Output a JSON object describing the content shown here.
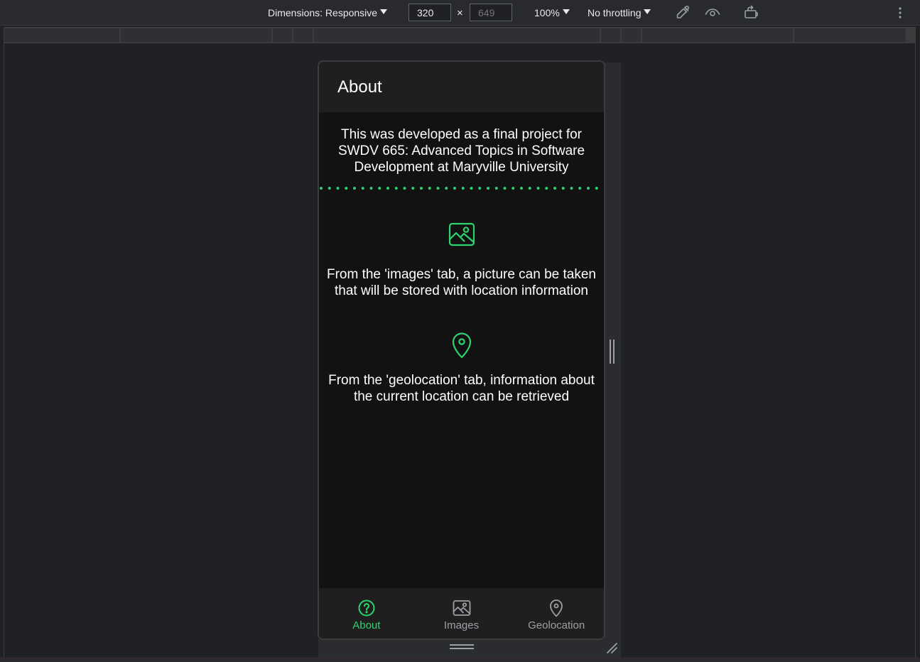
{
  "toolbar": {
    "dimensions_label": "Dimensions: Responsive",
    "width_value": "320",
    "height_placeholder": "649",
    "times": "×",
    "zoom_label": "100%",
    "throttle_label": "No throttling"
  },
  "app": {
    "title": "About",
    "intro_text": "This was developed as a final project for SWDV 665: Advanced Topics in Software Development at Maryville University",
    "features": [
      {
        "icon": "image-icon",
        "text": "From the 'images' tab, a picture can be taken that will be stored with location information"
      },
      {
        "icon": "location-pin-icon",
        "text": "From the 'geolocation' tab, information about the current location can be retrieved"
      }
    ],
    "tabs": [
      {
        "label": "About",
        "icon": "help-circle-icon",
        "active": true
      },
      {
        "label": "Images",
        "icon": "image-icon",
        "active": false
      },
      {
        "label": "Geolocation",
        "icon": "location-pin-icon",
        "active": false
      }
    ]
  },
  "colors": {
    "accent": "#2dd36f",
    "app_background": "#121212",
    "header_background": "#1f1f1f",
    "devtools_background": "#202124",
    "inactive_tab": "#9aa0a6"
  }
}
